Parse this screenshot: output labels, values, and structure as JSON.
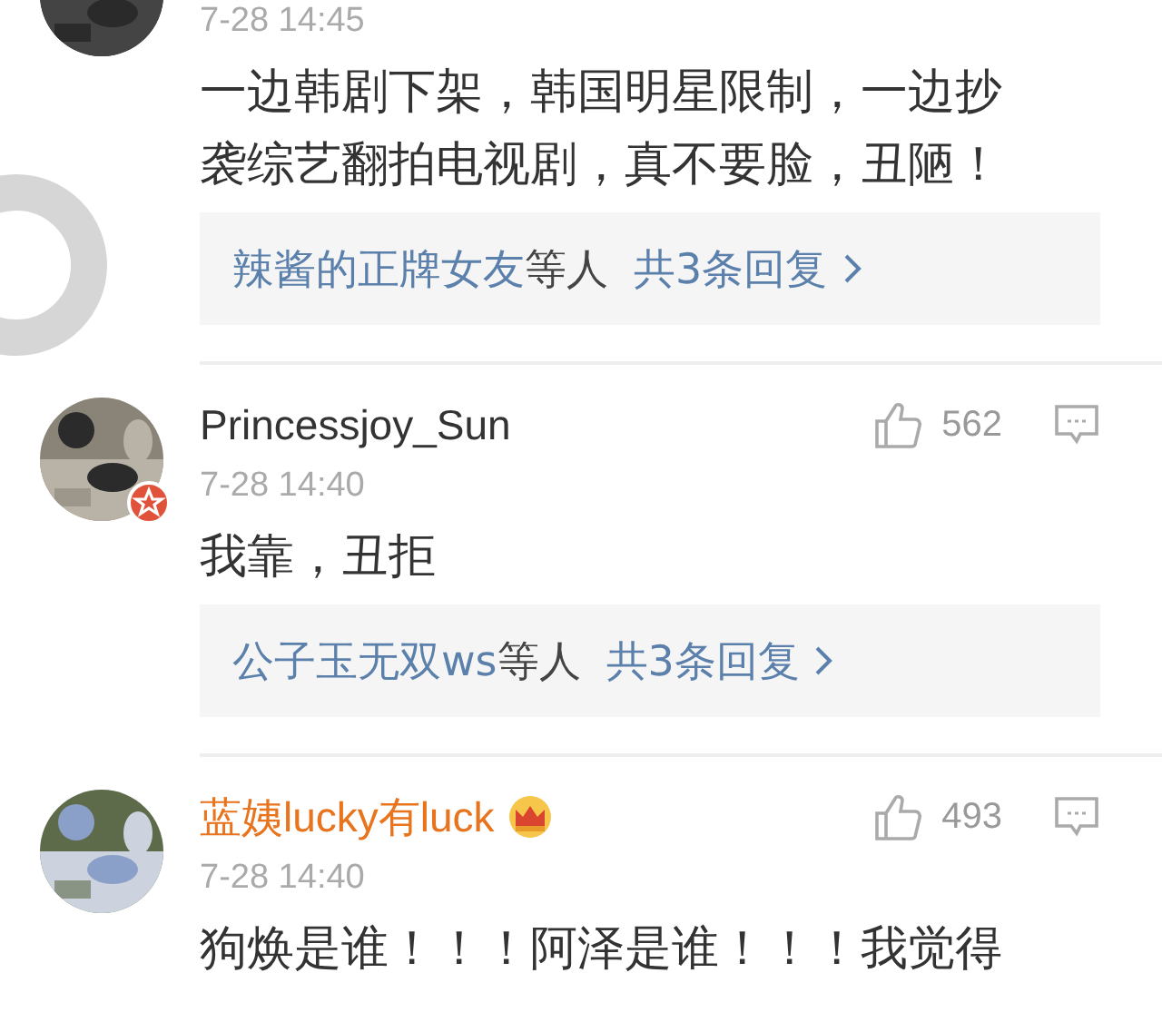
{
  "comments": [
    {
      "date": "7-28 14:45",
      "text": "一边韩剧下架，韩国明星限制，一边抄袭综艺翻拍电视剧，真不要脸，丑陋！",
      "replies": {
        "names": "辣酱的正牌女友",
        "suffix": "等人",
        "count": "共3条回复"
      }
    },
    {
      "name": "Princessjoy_Sun",
      "vip": false,
      "badge": true,
      "likes": "562",
      "date": "7-28 14:40",
      "text": "我靠，丑拒",
      "replies": {
        "names": "公子玉无双ws",
        "suffix": "等人",
        "count": "共3条回复"
      }
    },
    {
      "name": "蓝姨lucky有luck",
      "vip": true,
      "badge": false,
      "likes": "493",
      "date": "7-28 14:40",
      "text": "狗焕是谁！！！阿泽是谁！！！我觉得"
    }
  ]
}
